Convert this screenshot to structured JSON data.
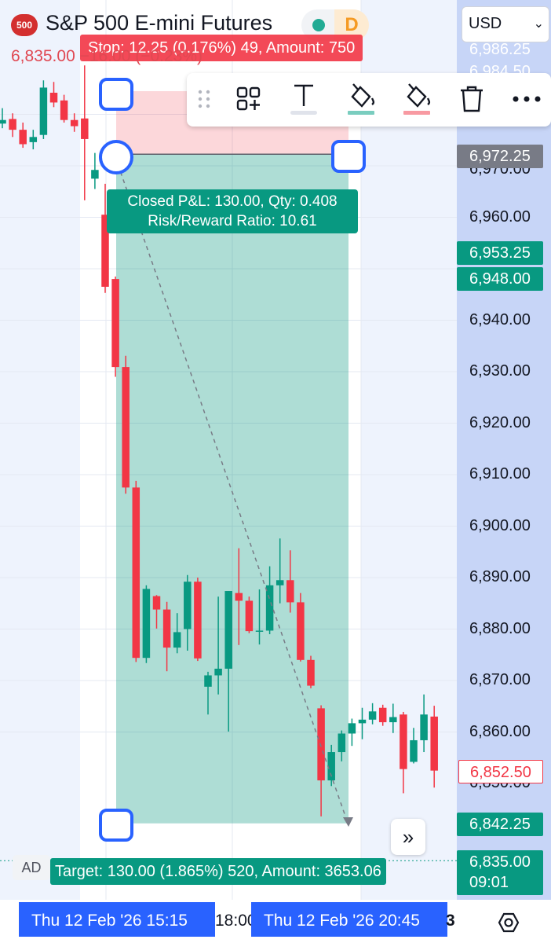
{
  "header": {
    "symbol_badge": "500",
    "title": "S&P 500 E-mini Futures",
    "interval_badge": "D",
    "currency": "USD",
    "price_change": "6,835.00 −16.00 (−0.23%)"
  },
  "position": {
    "stop_label": "Stop: 12.25 (0.176%) 49, Amount: 750",
    "closed_pl_line": "Closed P&L: 130.00, Qty: 0.408",
    "risk_reward_line": "Risk/Reward Ratio: 10.61",
    "target_label": "Target: 130.00 (1.865%) 520, Amount: 3653.06",
    "entry": 6972.25,
    "stop": 6984.5,
    "target": 6842.25
  },
  "toolbar": {
    "icons": [
      "drag-handle-icon",
      "add-widget-icon",
      "text-icon",
      "fill-color-icon",
      "stop-fill-color-icon",
      "delete-icon",
      "more-icon"
    ],
    "profit_color": "#089981",
    "loss_color": "#f23645",
    "accent_color": "#2962ff"
  },
  "price_axis": {
    "labels": [
      "6,960.00",
      "6,940.00",
      "6,930.00",
      "6,920.00",
      "6,910.00",
      "6,900.00",
      "6,890.00",
      "6,880.00",
      "6,870.00",
      "6,860.00"
    ],
    "partial_labels": [
      "6,986.25",
      "6,984.50",
      "6,970.00",
      "6,850.00"
    ],
    "tags": [
      {
        "text": "6,972.25",
        "color": "#787b86"
      },
      {
        "text": "6,953.25",
        "color": "#089981"
      },
      {
        "text": "6,948.00",
        "color": "#089981"
      },
      {
        "text": "6,852.50",
        "color": "#f23645"
      },
      {
        "text": "6,842.25",
        "color": "#089981"
      }
    ],
    "last_price": "6,835.00",
    "countdown": "09:01"
  },
  "time_axis": {
    "start_label": "Thu 12 Feb '26   15:15",
    "middle_label": "18:00",
    "end_label": "Thu 12 Feb '26   20:45",
    "trailing_label": "3"
  },
  "ad_badge": "AD",
  "scroll_button": "»",
  "chart_data": {
    "type": "candlestick",
    "title": "S&P 500 E-mini Futures",
    "ylim": [
      6830,
      6990
    ],
    "y_ticks": [
      6860,
      6870,
      6880,
      6890,
      6900,
      6910,
      6920,
      6930,
      6940,
      6960
    ],
    "up_color": "#089981",
    "down_color": "#f23645",
    "candles": [
      {
        "o": 6978.2,
        "h": 6981.2,
        "l": 6977.3,
        "c": 6978.9
      },
      {
        "o": 6979.1,
        "h": 6980.2,
        "l": 6975.6,
        "c": 6977.0
      },
      {
        "o": 6977.0,
        "h": 6978.4,
        "l": 6973.5,
        "c": 6974.2
      },
      {
        "o": 6974.6,
        "h": 6977.0,
        "l": 6973.2,
        "c": 6975.6
      },
      {
        "o": 6976.0,
        "h": 6986.6,
        "l": 6975.2,
        "c": 6985.2
      },
      {
        "o": 6984.2,
        "h": 6986.3,
        "l": 6981.4,
        "c": 6982.3
      },
      {
        "o": 6982.7,
        "h": 6983.8,
        "l": 6978.4,
        "c": 6978.9
      },
      {
        "o": 6978.9,
        "h": 6980.2,
        "l": 6976.6,
        "c": 6977.7
      },
      {
        "o": 6979.2,
        "h": 6989.5,
        "l": 6963.3,
        "c": 6975.2
      },
      {
        "o": 6967.5,
        "h": 6972.5,
        "l": 6965.5,
        "c": 6969.2
      },
      {
        "o": 6960.5,
        "h": 6966.5,
        "l": 6945.3,
        "c": 6946.5
      },
      {
        "o": 6948.0,
        "h": 6948.5,
        "l": 6929.0,
        "c": 6930.9
      },
      {
        "o": 6930.9,
        "h": 6933.1,
        "l": 6906.3,
        "c": 6907.5
      },
      {
        "o": 6907.5,
        "h": 6908.8,
        "l": 6873.6,
        "c": 6874.4
      },
      {
        "o": 6874.4,
        "h": 6888.5,
        "l": 6873.4,
        "c": 6887.8
      },
      {
        "o": 6886.4,
        "h": 6886.6,
        "l": 6880.1,
        "c": 6883.8
      },
      {
        "o": 6883.8,
        "h": 6885.3,
        "l": 6871.8,
        "c": 6876.4
      },
      {
        "o": 6876.4,
        "h": 6883.1,
        "l": 6875.3,
        "c": 6879.4
      },
      {
        "o": 6880.0,
        "h": 6890.5,
        "l": 6875.8,
        "c": 6889.2
      },
      {
        "o": 6889.2,
        "h": 6890.0,
        "l": 6873.8,
        "c": 6874.3
      },
      {
        "o": 6868.8,
        "h": 6871.7,
        "l": 6863.4,
        "c": 6871.0
      },
      {
        "o": 6871.0,
        "h": 6886.3,
        "l": 6867.3,
        "c": 6872.3
      },
      {
        "o": 6872.3,
        "h": 6887.4,
        "l": 6860.1,
        "c": 6887.4
      },
      {
        "o": 6887.0,
        "h": 6895.7,
        "l": 6876.9,
        "c": 6885.5
      },
      {
        "o": 6885.5,
        "h": 6886.3,
        "l": 6879.2,
        "c": 6879.6
      },
      {
        "o": 6879.6,
        "h": 6887.7,
        "l": 6877.0,
        "c": 6879.7
      },
      {
        "o": 6879.7,
        "h": 6892.2,
        "l": 6879.0,
        "c": 6888.5
      },
      {
        "o": 6888.5,
        "h": 6897.6,
        "l": 6885.0,
        "c": 6889.5
      },
      {
        "o": 6889.5,
        "h": 6895.3,
        "l": 6883.2,
        "c": 6885.2
      },
      {
        "o": 6885.2,
        "h": 6887.0,
        "l": 6873.7,
        "c": 6874.0
      },
      {
        "o": 6874.0,
        "h": 6874.8,
        "l": 6868.5,
        "c": 6869.0
      },
      {
        "o": 6864.6,
        "h": 6865.2,
        "l": 6843.6,
        "c": 6850.6
      },
      {
        "o": 6850.6,
        "h": 6857.5,
        "l": 6849.5,
        "c": 6856.1
      },
      {
        "o": 6856.1,
        "h": 6860.3,
        "l": 6854.3,
        "c": 6859.7
      },
      {
        "o": 6859.7,
        "h": 6862.6,
        "l": 6857.3,
        "c": 6861.7
      },
      {
        "o": 6861.7,
        "h": 6864.7,
        "l": 6858.6,
        "c": 6862.4
      },
      {
        "o": 6862.4,
        "h": 6865.6,
        "l": 6861.5,
        "c": 6864.0
      },
      {
        "o": 6864.7,
        "h": 6865.3,
        "l": 6861.2,
        "c": 6861.9
      },
      {
        "o": 6861.9,
        "h": 6865.5,
        "l": 6859.8,
        "c": 6862.9
      },
      {
        "o": 6863.4,
        "h": 6863.9,
        "l": 6848.1,
        "c": 6852.8
      },
      {
        "o": 6854.2,
        "h": 6860.8,
        "l": 6853.9,
        "c": 6858.4
      },
      {
        "o": 6858.4,
        "h": 6867.3,
        "l": 6856.1,
        "c": 6863.4
      },
      {
        "o": 6863.0,
        "h": 6865.1,
        "l": 6849.2,
        "c": 6852.5
      }
    ]
  }
}
